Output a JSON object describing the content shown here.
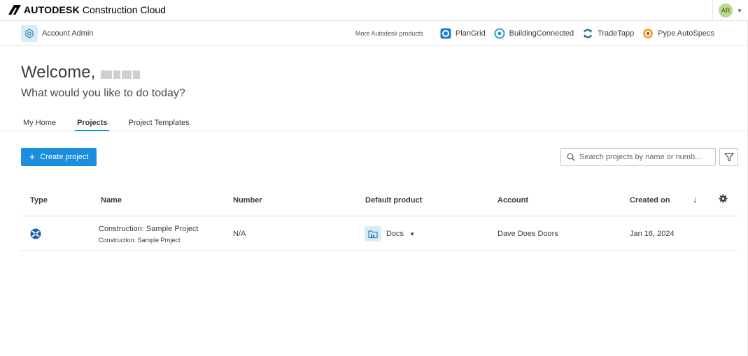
{
  "brand": {
    "name": "AUTODESK",
    "product": "Construction Cloud"
  },
  "user": {
    "initials": "AR"
  },
  "subbar": {
    "admin_label": "Account Admin",
    "more_label": "More Autodesk products",
    "products": [
      {
        "label": "PlanGrid",
        "icon": "plangrid-icon"
      },
      {
        "label": "BuildingConnected",
        "icon": "buildingconnected-icon"
      },
      {
        "label": "TradeTapp",
        "icon": "tradetapp-icon"
      },
      {
        "label": "Pype AutoSpecs",
        "icon": "pype-icon"
      }
    ]
  },
  "welcome": {
    "greeting": "Welcome,",
    "subtitle": "What would you like to do today?"
  },
  "tabs": [
    {
      "label": "My Home",
      "active": false
    },
    {
      "label": "Projects",
      "active": true
    },
    {
      "label": "Project Templates",
      "active": false
    }
  ],
  "toolbar": {
    "create_label": "Create project",
    "search_placeholder": "Search projects by name or numb..."
  },
  "table": {
    "columns": [
      "Type",
      "Name",
      "Number",
      "Default product",
      "Account",
      "Created on"
    ],
    "rows": [
      {
        "name": "Construction: Sample Project",
        "subname": "Construction: Sample Project",
        "number": "N/A",
        "default_product": "Docs",
        "account": "Dave Does Doors",
        "created_on": "Jan 16, 2024"
      }
    ]
  },
  "colors": {
    "accent": "#1b8ee0",
    "tab_underline": "#0696d7",
    "icon_bg": "#d9ecf5"
  }
}
